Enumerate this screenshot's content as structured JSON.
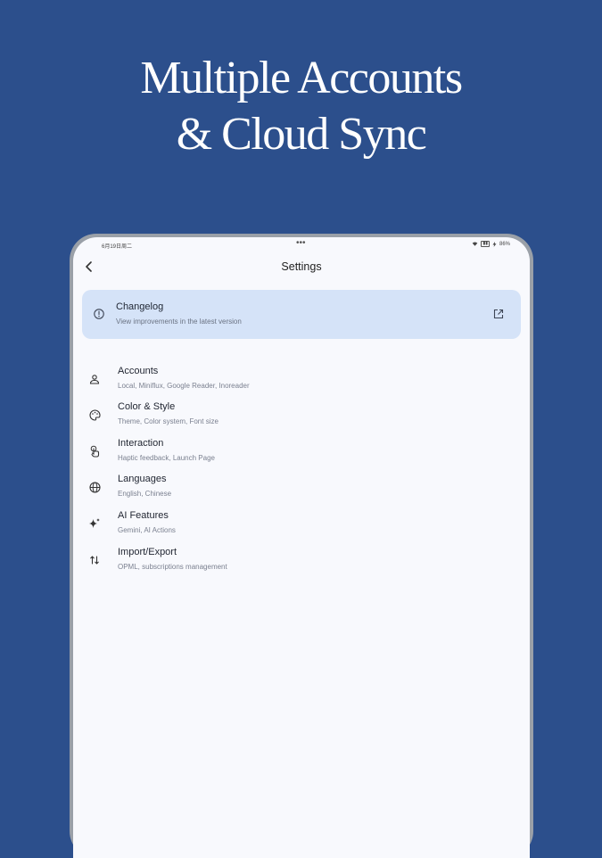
{
  "hero": {
    "line1": "Multiple Accounts",
    "line2": "& Cloud Sync"
  },
  "status_bar": {
    "time": "6月19日周二",
    "battery": "86%",
    "more_dots": "•••"
  },
  "app_bar": {
    "title": "Settings",
    "back_icon": "chevron-left-icon"
  },
  "changelog": {
    "title": "Changelog",
    "subtitle": "View improvements in the latest version",
    "icon": "info-icon",
    "action_icon": "open-external-icon"
  },
  "settings": {
    "items": [
      {
        "title": "Accounts",
        "subtitle": "Local, Miniflux, Google Reader, Inoreader",
        "icon": "person-icon"
      },
      {
        "title": "Color & Style",
        "subtitle": "Theme, Color system, Font size",
        "icon": "palette-icon"
      },
      {
        "title": "Interaction",
        "subtitle": "Haptic feedback, Launch Page",
        "icon": "touch-icon"
      },
      {
        "title": "Languages",
        "subtitle": "English, Chinese",
        "icon": "globe-icon"
      },
      {
        "title": "AI Features",
        "subtitle": "Gemini, AI Actions",
        "icon": "sparkle-icon"
      },
      {
        "title": "Import/Export",
        "subtitle": "OPML, subscriptions management",
        "icon": "swap-vertical-icon"
      }
    ]
  },
  "colors": {
    "background": "#2c4f8c",
    "screen": "#f8f9fd",
    "changelog_card": "#d5e3f8",
    "text_primary": "#1f2430",
    "text_secondary": "#7b8190"
  }
}
